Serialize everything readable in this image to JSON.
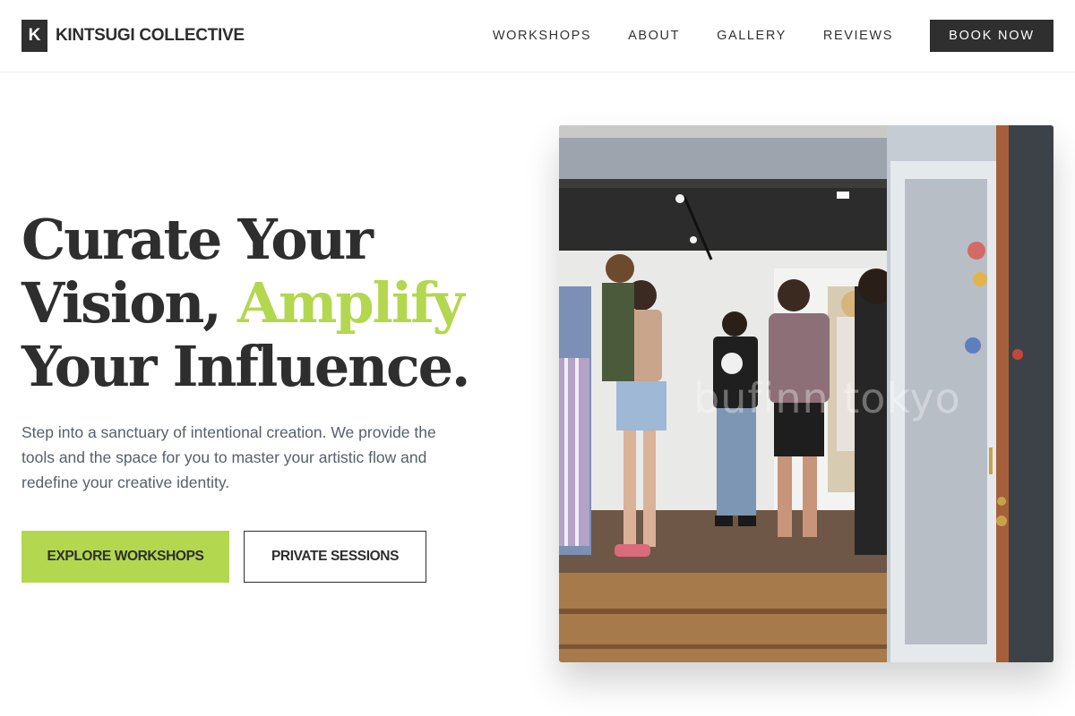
{
  "brand": {
    "mark": "K",
    "name": "KINTSUGI COLLECTIVE"
  },
  "nav": {
    "items": [
      {
        "label": "WORKSHOPS"
      },
      {
        "label": "ABOUT"
      },
      {
        "label": "GALLERY"
      },
      {
        "label": "REVIEWS"
      }
    ],
    "cta": "BOOK NOW"
  },
  "hero": {
    "title_line1": "Curate Your",
    "title_line2a": "Vision, ",
    "title_line2b": "Amplify",
    "title_line3": "Your Influence.",
    "subtitle": "Step into a sanctuary of intentional creation. We provide the tools and the space for you to master your artistic flow and redefine your creative identity.",
    "primary_button": "EXPLORE WORKSHOPS",
    "secondary_button": "PRIVATE SESSIONS",
    "image_watermark": "bufinn tokyo"
  },
  "colors": {
    "accent": "#b3d74f",
    "dark": "#2f2f2f",
    "text_muted": "#56606a"
  }
}
